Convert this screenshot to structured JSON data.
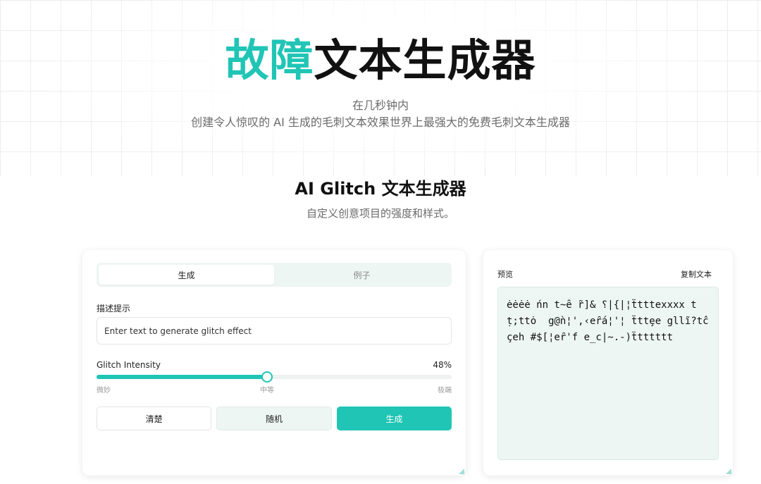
{
  "hero": {
    "title_accent": "故障",
    "title_rest": "文本生成器",
    "subtitle_line1": "在几秒钟内",
    "subtitle_line2": "创建令人惊叹的 AI 生成的毛刺文本效果世界上最强大的免费毛刺文本生成器"
  },
  "section": {
    "title": "AI Glitch 文本生成器",
    "subtitle": "自定义创意项目的强度和样式。"
  },
  "generator": {
    "tabs": [
      {
        "label": "生成",
        "active": true
      },
      {
        "label": "例子",
        "active": false
      }
    ],
    "prompt_label": "描述提示",
    "prompt_placeholder": "Enter text to generate glitch effect",
    "prompt_value": "",
    "intensity_label": "Glitch Intensity",
    "intensity_percent": 48,
    "intensity_display": "48%",
    "ticks": [
      "微妙",
      "中等",
      "极端"
    ],
    "buttons": {
      "clear": "清楚",
      "random": "随机",
      "generate": "生成"
    }
  },
  "preview": {
    "label": "预览",
    "copy_label": "复制文本",
    "text": "ėėėė ńn t̴ȇ r̃]& ⸮|{|¦ẗtttexxxx t ṭ;ttȯ  g@ǹ¦',‹eȓá¦'¦ ẗttȩe gllĩ?tĉçeh #$[¦eȓ'f e_c|~.-)ẗtttttt"
  },
  "colors": {
    "accent": "#20c5b5",
    "preview_bg": "#eef6f4"
  }
}
